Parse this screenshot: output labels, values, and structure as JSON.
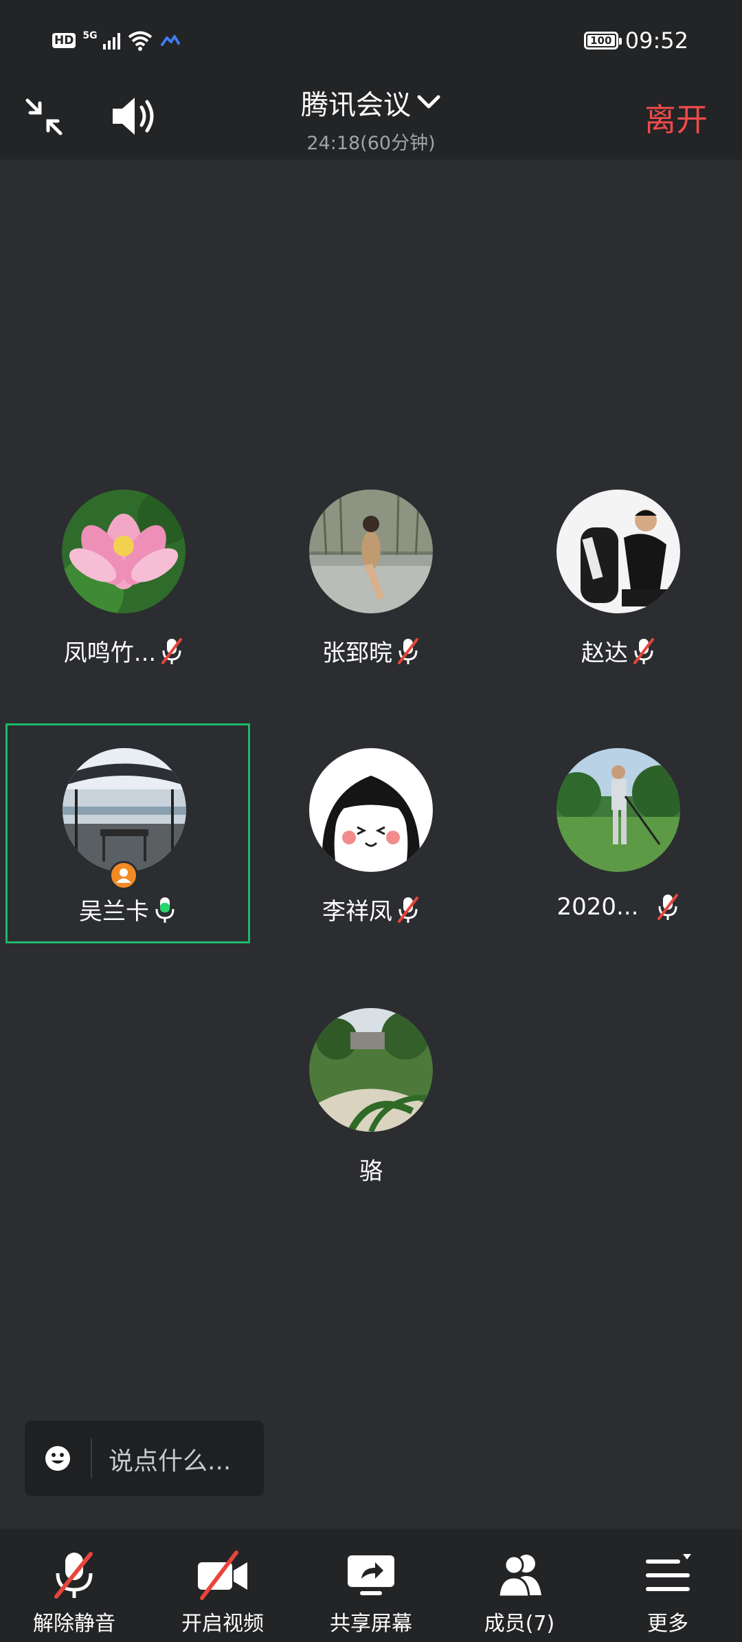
{
  "status_bar": {
    "hd": "HD",
    "network": "5G",
    "battery": "100",
    "time": "09:52",
    "icons": [
      "hd-icon",
      "signal-icon",
      "wifi-icon",
      "cloud-icon",
      "battery-icon"
    ]
  },
  "top_bar": {
    "title": "腾讯会议",
    "duration": "24:18(60分钟)",
    "leave_label": "离开",
    "icons": [
      "shrink-icon",
      "speaker-icon",
      "chevron-down-icon"
    ]
  },
  "participants": [
    {
      "name": "凤鸣竹...",
      "muted": true
    },
    {
      "name": "张郅晥",
      "muted": true
    },
    {
      "name": "赵达",
      "muted": true
    },
    {
      "name": "吴兰卡",
      "muted": false,
      "speaking": true,
      "host": true
    },
    {
      "name": "李祥凤",
      "muted": true
    },
    {
      "name": "2020...",
      "muted": true
    },
    {
      "name": "骆",
      "muted": false
    }
  ],
  "chat": {
    "placeholder": "说点什么..."
  },
  "toolbar": {
    "unmute_label": "解除静音",
    "video_label": "开启视频",
    "share_label": "共享屏幕",
    "members_label": "成员(7)",
    "more_label": "更多"
  },
  "colors": {
    "background": "#2b2d30",
    "bar": "#232426",
    "leave": "#f04b4b",
    "active_border": "#1fb76a",
    "muted_slash": "#e8453c",
    "host_badge": "#f28a26"
  }
}
